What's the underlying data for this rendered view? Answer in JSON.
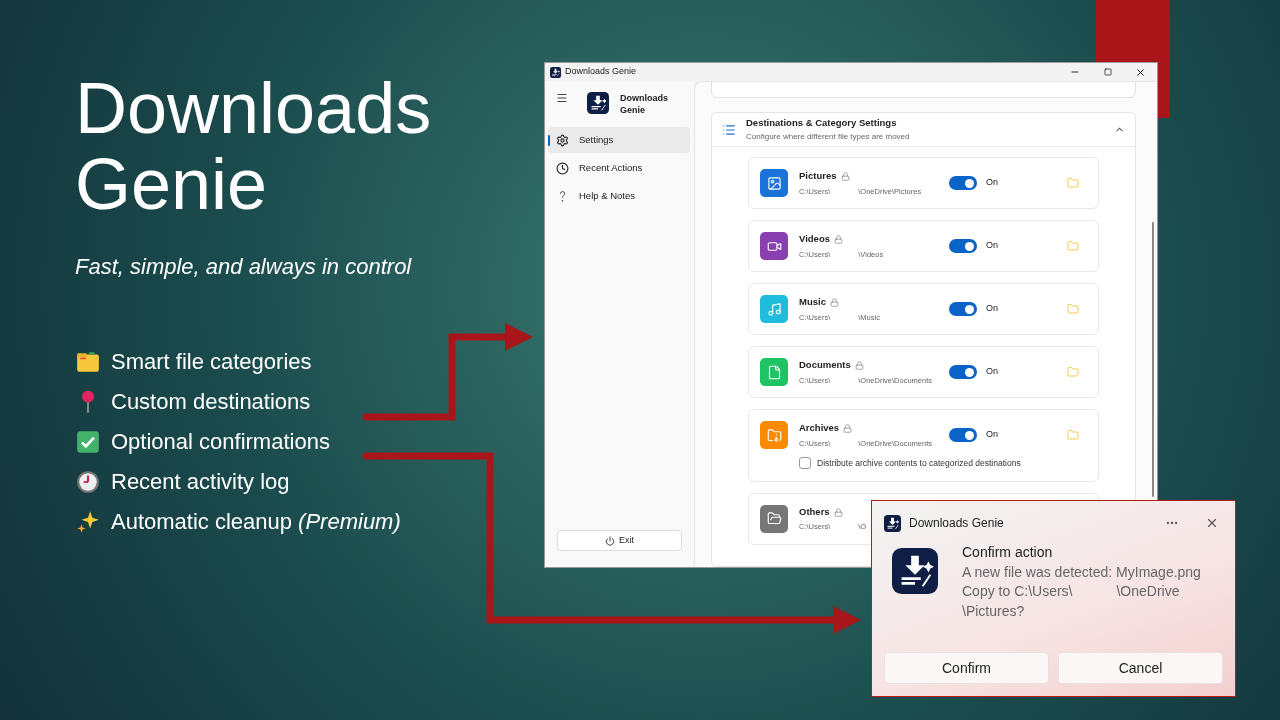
{
  "slide": {
    "title": "Downloads Genie",
    "subtitle": "Fast, simple, and always in control",
    "bullets": [
      {
        "kind": "folder",
        "text": "Smart file categories"
      },
      {
        "kind": "pin",
        "text": "Custom destinations"
      },
      {
        "kind": "check",
        "text": "Optional confirmations"
      },
      {
        "kind": "clock",
        "text": "Recent activity log"
      },
      {
        "kind": "sparkles",
        "text": "Automatic cleanup *(Premium)*"
      }
    ]
  },
  "window": {
    "title": "Downloads Genie",
    "sidebar": {
      "app_name": "Downloads Genie",
      "items": [
        {
          "kind": "settings",
          "label": "Settings",
          "selected": true
        },
        {
          "kind": "recent",
          "label": "Recent Actions",
          "selected": false
        },
        {
          "kind": "help",
          "label": "Help & Notes",
          "selected": false
        }
      ],
      "exit_button": "Exit"
    },
    "section": {
      "title": "Destinations & Category Settings",
      "subtitle": "Configure where different file types are moved",
      "expanded": true,
      "categories": [
        {
          "kind": "pictures",
          "name": "Pictures",
          "color": "#1a73d9",
          "path": [
            "C:\\Users\\",
            "\\OneDrive\\Pictures"
          ],
          "on": true,
          "state": "On"
        },
        {
          "kind": "videos",
          "name": "Videos",
          "color": "#8a3fb0",
          "path": [
            "C:\\Users\\",
            "\\Videos"
          ],
          "on": true,
          "state": "On"
        },
        {
          "kind": "music",
          "name": "Music",
          "color": "#1fbcdc",
          "path": [
            "C:\\Users\\",
            "\\Music"
          ],
          "on": true,
          "state": "On"
        },
        {
          "kind": "documents",
          "name": "Documents",
          "color": "#1fc462",
          "path": [
            "C:\\Users\\",
            "\\OneDrive\\Documents"
          ],
          "on": true,
          "state": "On"
        },
        {
          "kind": "archives",
          "name": "Archives",
          "color": "#fb8a00",
          "path": [
            "C:\\Users\\",
            "\\OneDrive\\Documents"
          ],
          "on": true,
          "state": "On",
          "option": {
            "label": "Distribute archive contents to categorized destinations",
            "checked": false
          }
        },
        {
          "kind": "others",
          "name": "Others",
          "color": "#777777",
          "path": [
            "C:\\Users\\",
            "\\O"
          ]
        }
      ]
    }
  },
  "notification": {
    "app_name": "Downloads Genie",
    "title": "Confirm action",
    "line_1": "A new file was detected: MyImage.png",
    "line_2": [
      "Copy to C:\\Users\\",
      "\\OneDrive"
    ],
    "line_3": "\\Pictures?",
    "buttons": [
      "Confirm",
      "Cancel"
    ]
  }
}
